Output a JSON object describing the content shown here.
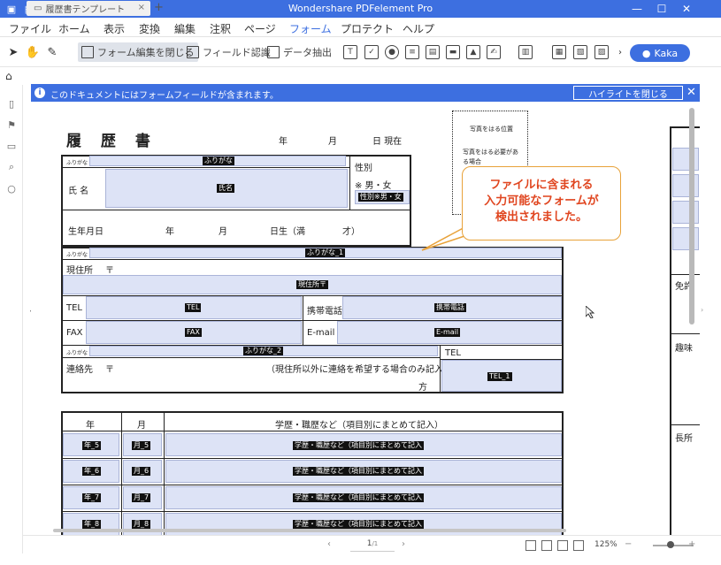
{
  "titlebar": {
    "title": "Wondershare PDFelement Pro",
    "minimize": "—",
    "maximize": "☐",
    "close": "✕"
  },
  "menu": [
    "ファイル",
    "ホーム",
    "表示",
    "変換",
    "編集",
    "注釈",
    "ページ",
    "フォーム",
    "プロテクト",
    "ヘルプ"
  ],
  "toolbar": {
    "close_form_edit": "フォーム編集を閉じる",
    "field_recognition": "フィールド認識",
    "data_extract": "データ抽出",
    "user": "Kaka"
  },
  "tab": {
    "name": "履歴書テンプレート",
    "close": "×",
    "add": "+"
  },
  "notice": {
    "message": "このドキュメントにはフォームフィールドが含まれます。",
    "highlight_button": "ハイライトを閉じる",
    "close": "✕"
  },
  "callout": {
    "line1": "ファイルに含まれる",
    "line2": "入力可能なフォームが",
    "line3": "検出されました。"
  },
  "document": {
    "title": "履 歴 書",
    "date_year": "年",
    "date_month": "月",
    "date_day": "日 現在",
    "photo_title": "写真をはる位置",
    "photo_note1": "写真をはる必要があ",
    "photo_note2": "る場合",
    "furigana": "ふりがな",
    "name_label": "氏  名",
    "gender_label": "性別",
    "gender_options": "※  男・女",
    "birth_label": "生年月日",
    "birth_year": "年",
    "birth_month": "月",
    "birth_day": "日生（満",
    "birth_age": "才）",
    "address_label": "現住所",
    "postal": "〒",
    "tel_label": "TEL",
    "mobile_label": "携帯電話",
    "fax_label": "FAX",
    "email_label": "E-mail",
    "contact_label": "連絡先",
    "contact_note": "（現住所以外に連絡を希望する場合のみ記入）",
    "contact_suffix": "方",
    "tel2_label": "TEL",
    "history_year": "年",
    "history_month": "月",
    "history_desc": "学歴・職歴など（項目別にまとめて記入）",
    "right_col1": "免許",
    "right_col2": "趣味",
    "right_col3": "長所"
  },
  "fields": {
    "furigana": "ふりがな",
    "name": "氏名",
    "gender": "性別※男・女",
    "furigana_1": "ふりがな_1",
    "address": "現住所〒",
    "tel": "TEL",
    "mobile": "携帯電話",
    "fax": "FAX",
    "email": "E-mail",
    "furigana_2": "ふりがな_2",
    "tel_1": "TEL_1",
    "history_rows": [
      {
        "year": "年_5",
        "month": "月_5",
        "desc": "学歴・職歴など（項目別にまとめて記入"
      },
      {
        "year": "年_6",
        "month": "月_6",
        "desc": "学歴・職歴など（項目別にまとめて記入"
      },
      {
        "year": "年_7",
        "month": "月_7",
        "desc": "学歴・職歴など（項目別にまとめて記入"
      },
      {
        "year": "年_8",
        "month": "月_8",
        "desc": "学歴・職歴など（項目別にまとめて記入"
      }
    ]
  },
  "status": {
    "page": "1",
    "page_total": "/1",
    "zoom": "125%"
  }
}
